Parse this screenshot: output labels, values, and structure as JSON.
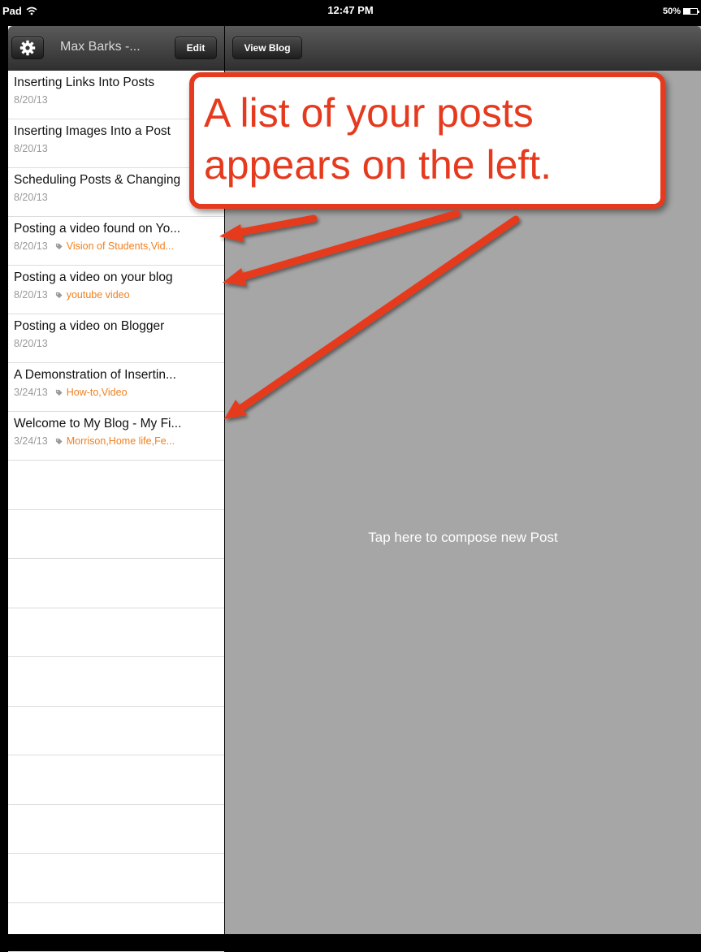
{
  "status_bar": {
    "device": "Pad",
    "time": "12:47 PM",
    "battery_label": "50%",
    "battery_level": 0.5
  },
  "left_toolbar": {
    "blog_title": "Max Barks -...",
    "edit_label": "Edit"
  },
  "posts": [
    {
      "title": "Inserting Links Into Posts",
      "date": "8/20/13",
      "tags": ""
    },
    {
      "title": "Inserting Images Into a Post",
      "date": "8/20/13",
      "tags": ""
    },
    {
      "title": "Scheduling Posts & Changing",
      "date": "8/20/13",
      "tags": ""
    },
    {
      "title": "Posting a video found on Yo...",
      "date": "8/20/13",
      "tags": "Vision of Students,Vid..."
    },
    {
      "title": "Posting a video on your blog",
      "date": "8/20/13",
      "tags": "youtube video"
    },
    {
      "title": "Posting a video on Blogger",
      "date": "8/20/13",
      "tags": ""
    },
    {
      "title": "A Demonstration of Insertin...",
      "date": "3/24/13",
      "tags": "How-to,Video"
    },
    {
      "title": "Welcome to My Blog - My Fi...",
      "date": "3/24/13",
      "tags": "Morrison,Home life,Fe..."
    }
  ],
  "right_toolbar": {
    "view_blog_label": "View Blog"
  },
  "compose": {
    "text": "Tap here to compose new Post"
  },
  "annotation": {
    "line1": "A list of your posts",
    "line2": "appears on the left.",
    "color": "#e53a1e"
  }
}
